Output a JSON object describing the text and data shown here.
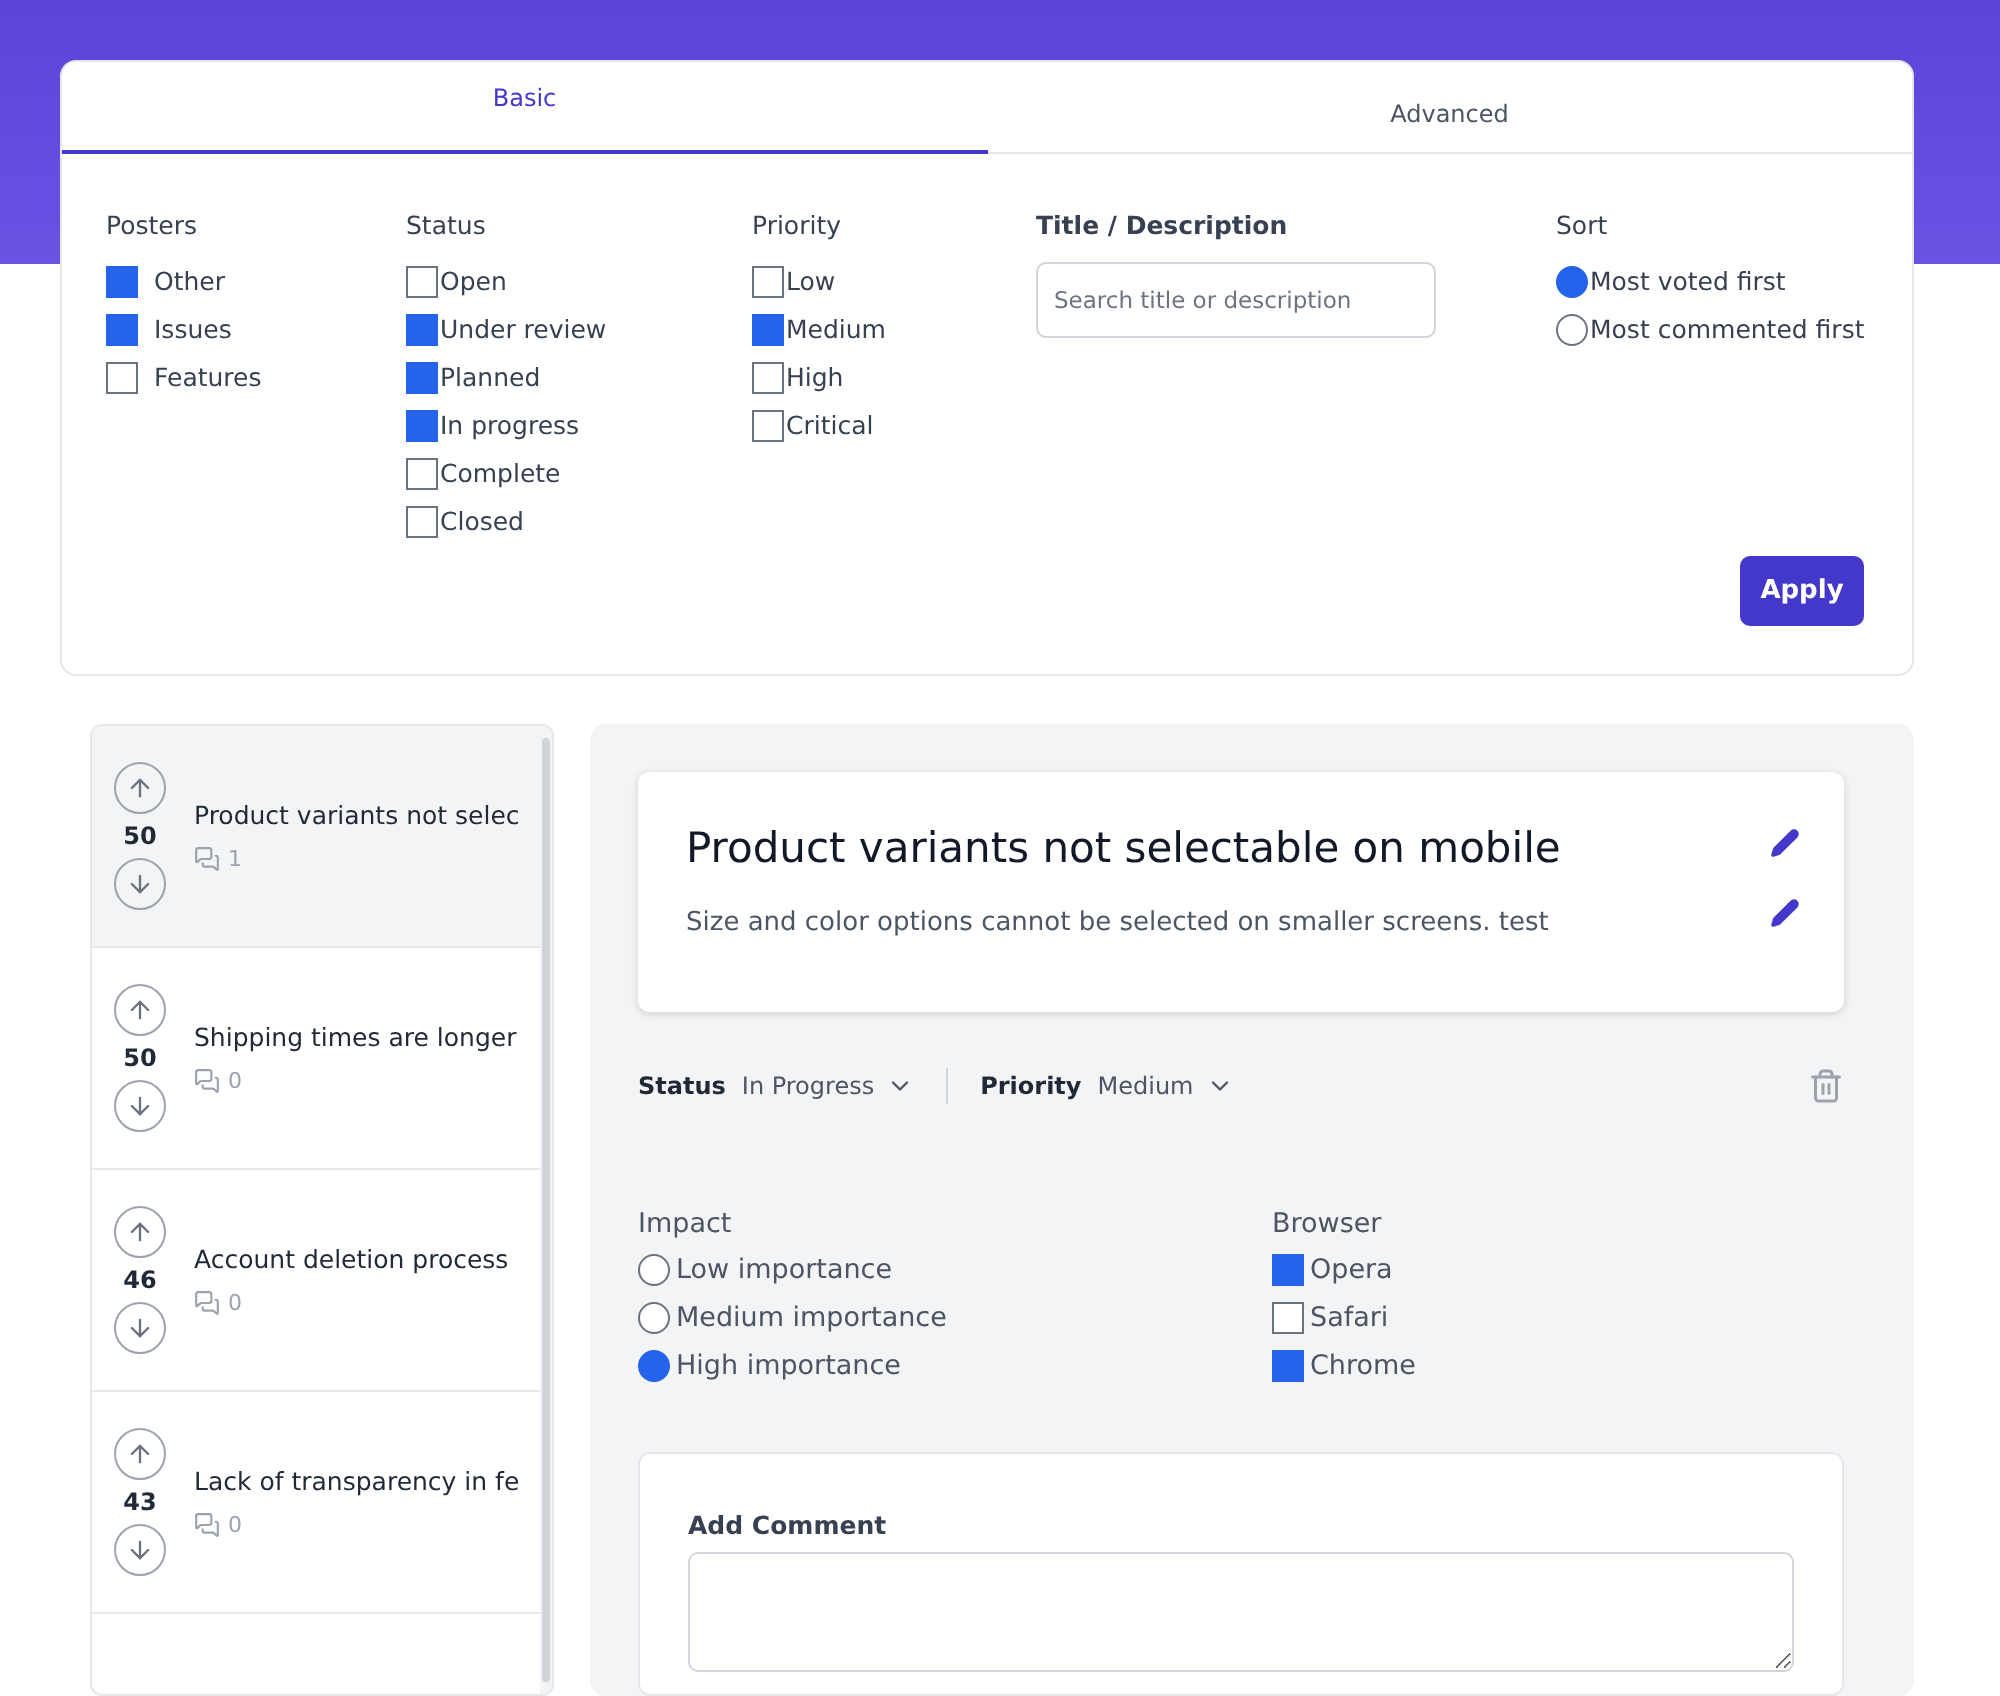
{
  "tabs": [
    {
      "label": "Basic",
      "selected": true
    },
    {
      "label": "Advanced",
      "selected": false
    }
  ],
  "filters": [
    {
      "kind": "checkbox",
      "label": "Posters",
      "options": [
        {
          "label": "Other",
          "checked": true
        },
        {
          "label": "Issues",
          "checked": true
        },
        {
          "label": "Features",
          "checked": false
        }
      ]
    },
    {
      "kind": "checkbox",
      "label": "Status",
      "options": [
        {
          "label": "Open",
          "checked": false
        },
        {
          "label": "Under review",
          "checked": true
        },
        {
          "label": "Planned",
          "checked": true
        },
        {
          "label": "In progress",
          "checked": true
        },
        {
          "label": "Complete",
          "checked": false
        },
        {
          "label": "Closed",
          "checked": false
        }
      ]
    },
    {
      "kind": "checkbox",
      "label": "Priority",
      "options": [
        {
          "label": "Low",
          "checked": false
        },
        {
          "label": "Medium",
          "checked": true
        },
        {
          "label": "High",
          "checked": false
        },
        {
          "label": "Critical",
          "checked": false
        }
      ]
    },
    {
      "kind": "search",
      "label": "Title / Description",
      "placeholder": "Search title or description"
    },
    {
      "kind": "radio",
      "label": "Sort",
      "options": [
        {
          "label": "Most voted first",
          "selected": true
        },
        {
          "label": "Most commented first",
          "selected": false
        }
      ]
    }
  ],
  "apply_button": "Apply",
  "posts": [
    {
      "votes": "50",
      "title": "Product variants not selec",
      "comments": "1",
      "selected": true
    },
    {
      "votes": "50",
      "title": "Shipping times are longer",
      "comments": "0",
      "selected": false
    },
    {
      "votes": "46",
      "title": "Account deletion process",
      "comments": "0",
      "selected": false
    },
    {
      "votes": "43",
      "title": "Lack of transparency in fe",
      "comments": "0",
      "selected": false
    }
  ],
  "detail": {
    "title": "Product variants not selectable on mobile",
    "description": "Size and color options cannot be selected on smaller screens. test",
    "status": {
      "label": "Status",
      "value": "In Progress"
    },
    "priority": {
      "label": "Priority",
      "value": "Medium"
    },
    "impact": {
      "label": "Impact",
      "options": [
        {
          "label": "Low importance",
          "selected": false
        },
        {
          "label": "Medium importance",
          "selected": false
        },
        {
          "label": "High importance",
          "selected": true
        }
      ]
    },
    "browser": {
      "label": "Browser",
      "options": [
        {
          "label": "Opera",
          "checked": true
        },
        {
          "label": "Safari",
          "checked": false
        },
        {
          "label": "Chrome",
          "checked": true
        }
      ]
    },
    "comment": {
      "label": "Add Comment"
    }
  }
}
